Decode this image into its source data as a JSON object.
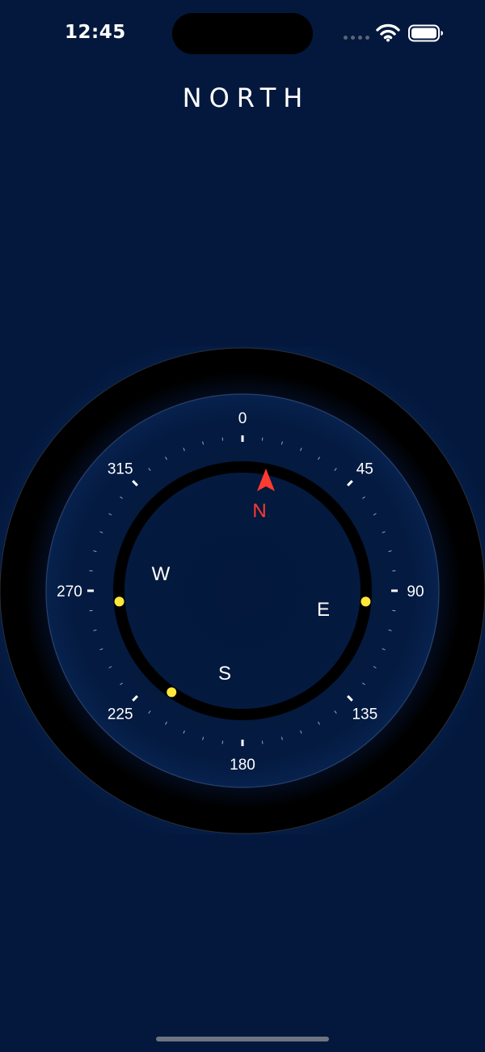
{
  "status_bar": {
    "time": "12:45",
    "icons": [
      "cellular-signal-icon",
      "wifi-icon",
      "battery-icon"
    ]
  },
  "heading": "NORTH",
  "compass": {
    "heading_degrees": 0,
    "degree_labels": [
      {
        "deg": 0,
        "text": "0"
      },
      {
        "deg": 45,
        "text": "45"
      },
      {
        "deg": 90,
        "text": "90"
      },
      {
        "deg": 135,
        "text": "135"
      },
      {
        "deg": 180,
        "text": "180"
      },
      {
        "deg": 225,
        "text": "225"
      },
      {
        "deg": 270,
        "text": "270"
      },
      {
        "deg": 315,
        "text": "315"
      }
    ],
    "cardinals": {
      "north": "N",
      "east": "E",
      "south": "S",
      "west": "W"
    },
    "needle_icon": "north-arrow-icon",
    "markers_degrees": [
      -95,
      95,
      215
    ]
  },
  "colors": {
    "background": "#03183c",
    "needle": "#ff3b30",
    "north_label": "#ff3b30",
    "marker": "#ffe83a",
    "text": "#ffffff"
  }
}
